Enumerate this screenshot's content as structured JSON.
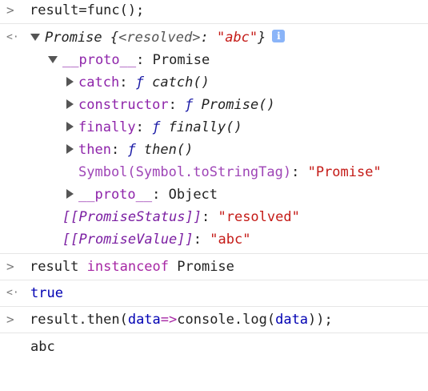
{
  "prompts": {
    "input": ">",
    "output": "<·"
  },
  "lines": {
    "l1": {
      "text": "result=func();"
    },
    "l2": {
      "p1": "Promise {",
      "p2": "<resolved>",
      "p3": ": ",
      "p4": "\"abc\"",
      "p5": "}",
      "info": "i"
    },
    "l3": {
      "key": "__proto__",
      "sep": ": ",
      "val": "Promise"
    },
    "l4": {
      "key": "catch",
      "sep": ": ",
      "f": "ƒ",
      "val": " catch()"
    },
    "l5": {
      "key": "constructor",
      "sep": ": ",
      "f": "ƒ",
      "val": " Promise()"
    },
    "l6": {
      "key": "finally",
      "sep": ": ",
      "f": "ƒ",
      "val": " finally()"
    },
    "l7": {
      "key": "then",
      "sep": ": ",
      "f": "ƒ",
      "val": " then()"
    },
    "l8": {
      "key": "Symbol(Symbol.toStringTag)",
      "sep": ": ",
      "val": "\"Promise\""
    },
    "l9": {
      "key": "__proto__",
      "sep": ": ",
      "val": "Object"
    },
    "l10": {
      "key": "[[PromiseStatus]]",
      "sep": ": ",
      "val": "\"resolved\""
    },
    "l11": {
      "key": "[[PromiseValue]]",
      "sep": ": ",
      "val": "\"abc\""
    },
    "l12": {
      "a": "result ",
      "kw": "instanceof",
      "b": " Promise"
    },
    "l13": {
      "text": "true"
    },
    "l14": {
      "a": "result.then(",
      "arg": "data",
      "arrow": "=>",
      "b": "console.log(",
      "arg2": "data",
      "c": "));"
    },
    "l15": {
      "text": "abc"
    }
  }
}
